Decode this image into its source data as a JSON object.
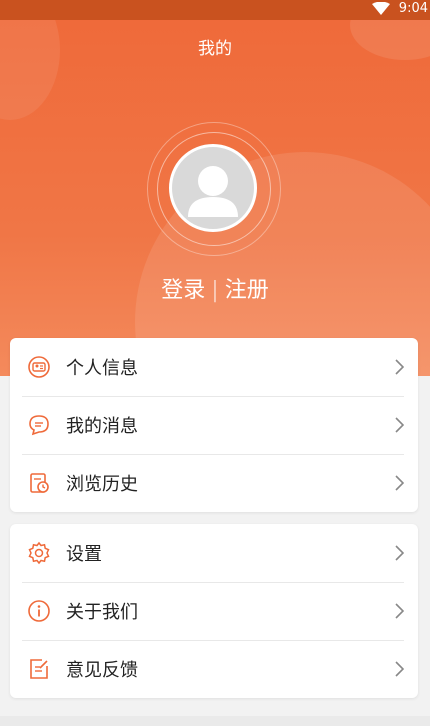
{
  "status_bar": {
    "time": "9:04"
  },
  "header": {
    "title": "我的"
  },
  "account": {
    "login": "登录",
    "separator": "|",
    "register": "注册"
  },
  "menu_group_1": [
    {
      "label": "个人信息",
      "icon": "id-card-icon"
    },
    {
      "label": "我的消息",
      "icon": "chat-bubble-icon"
    },
    {
      "label": "浏览历史",
      "icon": "history-icon"
    }
  ],
  "menu_group_2": [
    {
      "label": "设置",
      "icon": "gear-icon"
    },
    {
      "label": "关于我们",
      "icon": "info-icon"
    },
    {
      "label": "意见反馈",
      "icon": "feedback-icon"
    }
  ],
  "colors": {
    "accent": "#ef6a3a",
    "status_bar": "#c9521f"
  }
}
